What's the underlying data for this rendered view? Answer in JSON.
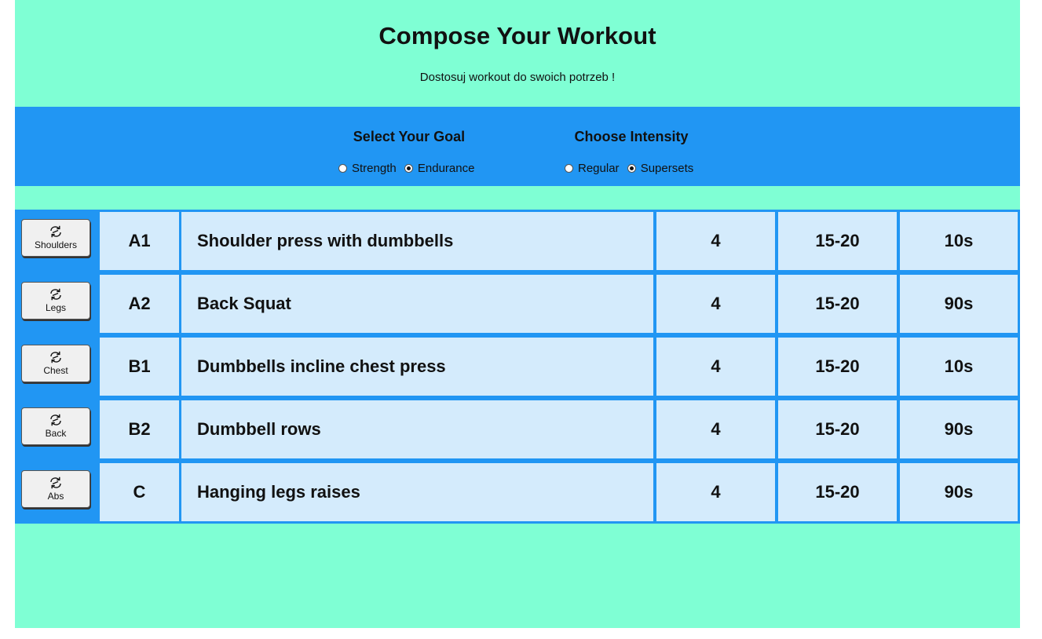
{
  "header": {
    "title": "Compose Your Workout",
    "subtitle": "Dostosuj workout do swoich potrzeb !"
  },
  "goal": {
    "heading": "Select Your Goal",
    "options": [
      {
        "label": "Strength",
        "checked": false
      },
      {
        "label": "Endurance",
        "checked": true
      }
    ]
  },
  "intensity": {
    "heading": "Choose Intensity",
    "options": [
      {
        "label": "Regular",
        "checked": false
      },
      {
        "label": "Supersets",
        "checked": true
      }
    ]
  },
  "workout": {
    "rows": [
      {
        "muscle": "Shoulders",
        "code": "A1",
        "exercise": "Shoulder press with dumbbells",
        "sets": "4",
        "reps": "15-20",
        "rest": "10s"
      },
      {
        "muscle": "Legs",
        "code": "A2",
        "exercise": "Back Squat",
        "sets": "4",
        "reps": "15-20",
        "rest": "90s"
      },
      {
        "muscle": "Chest",
        "code": "B1",
        "exercise": "Dumbbells incline chest press",
        "sets": "4",
        "reps": "15-20",
        "rest": "10s"
      },
      {
        "muscle": "Back",
        "code": "B2",
        "exercise": "Dumbbell rows",
        "sets": "4",
        "reps": "15-20",
        "rest": "90s"
      },
      {
        "muscle": "Abs",
        "code": "C",
        "exercise": "Hanging legs raises",
        "sets": "4",
        "reps": "15-20",
        "rest": "90s"
      }
    ]
  },
  "icons": {
    "swap": "swap-arrows-icon"
  },
  "colors": {
    "page_background": "#7fffd4",
    "controls_background": "#2196f3",
    "cell_background": "#d4ebfc",
    "cell_border": "#2196f3"
  }
}
